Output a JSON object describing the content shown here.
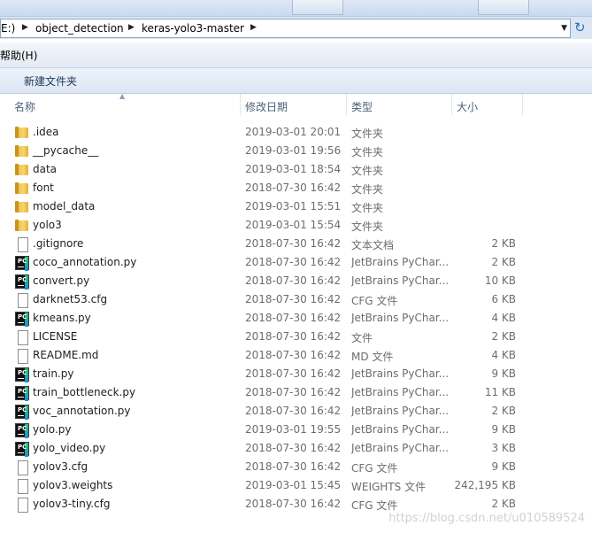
{
  "address_bar": {
    "crumbs": [
      "E:)",
      "object_detection",
      "keras-yolo3-master"
    ]
  },
  "menu": {
    "help": "帮助(H)"
  },
  "toolbar": {
    "new_folder": "新建文件夹"
  },
  "columns": {
    "name": "名称",
    "date": "修改日期",
    "type": "类型",
    "size": "大小"
  },
  "files": [
    {
      "name": ".idea",
      "date": "2019-03-01 20:01",
      "type": "文件夹",
      "size": "",
      "icon": "folder"
    },
    {
      "name": "__pycache__",
      "date": "2019-03-01 19:56",
      "type": "文件夹",
      "size": "",
      "icon": "folder"
    },
    {
      "name": "data",
      "date": "2019-03-01 18:54",
      "type": "文件夹",
      "size": "",
      "icon": "folder"
    },
    {
      "name": "font",
      "date": "2018-07-30 16:42",
      "type": "文件夹",
      "size": "",
      "icon": "folder"
    },
    {
      "name": "model_data",
      "date": "2019-03-01 15:51",
      "type": "文件夹",
      "size": "",
      "icon": "folder"
    },
    {
      "name": "yolo3",
      "date": "2019-03-01 15:54",
      "type": "文件夹",
      "size": "",
      "icon": "folder"
    },
    {
      "name": ".gitignore",
      "date": "2018-07-30 16:42",
      "type": "文本文档",
      "size": "2 KB",
      "icon": "file"
    },
    {
      "name": "coco_annotation.py",
      "date": "2018-07-30 16:42",
      "type": "JetBrains PyChar...",
      "size": "2 KB",
      "icon": "pycharm"
    },
    {
      "name": "convert.py",
      "date": "2018-07-30 16:42",
      "type": "JetBrains PyChar...",
      "size": "10 KB",
      "icon": "pycharm"
    },
    {
      "name": "darknet53.cfg",
      "date": "2018-07-30 16:42",
      "type": "CFG 文件",
      "size": "6 KB",
      "icon": "file"
    },
    {
      "name": "kmeans.py",
      "date": "2018-07-30 16:42",
      "type": "JetBrains PyChar...",
      "size": "4 KB",
      "icon": "pycharm"
    },
    {
      "name": "LICENSE",
      "date": "2018-07-30 16:42",
      "type": "文件",
      "size": "2 KB",
      "icon": "file"
    },
    {
      "name": "README.md",
      "date": "2018-07-30 16:42",
      "type": "MD 文件",
      "size": "4 KB",
      "icon": "file"
    },
    {
      "name": "train.py",
      "date": "2018-07-30 16:42",
      "type": "JetBrains PyChar...",
      "size": "9 KB",
      "icon": "pycharm"
    },
    {
      "name": "train_bottleneck.py",
      "date": "2018-07-30 16:42",
      "type": "JetBrains PyChar...",
      "size": "11 KB",
      "icon": "pycharm"
    },
    {
      "name": "voc_annotation.py",
      "date": "2018-07-30 16:42",
      "type": "JetBrains PyChar...",
      "size": "2 KB",
      "icon": "pycharm"
    },
    {
      "name": "yolo.py",
      "date": "2019-03-01 19:55",
      "type": "JetBrains PyChar...",
      "size": "9 KB",
      "icon": "pycharm"
    },
    {
      "name": "yolo_video.py",
      "date": "2018-07-30 16:42",
      "type": "JetBrains PyChar...",
      "size": "3 KB",
      "icon": "pycharm"
    },
    {
      "name": "yolov3.cfg",
      "date": "2018-07-30 16:42",
      "type": "CFG 文件",
      "size": "9 KB",
      "icon": "file"
    },
    {
      "name": "yolov3.weights",
      "date": "2019-03-01 15:45",
      "type": "WEIGHTS 文件",
      "size": "242,195 KB",
      "icon": "file"
    },
    {
      "name": "yolov3-tiny.cfg",
      "date": "2018-07-30 16:42",
      "type": "CFG 文件",
      "size": "2 KB",
      "icon": "file"
    }
  ],
  "watermark": "https://blog.csdn.net/u010589524"
}
